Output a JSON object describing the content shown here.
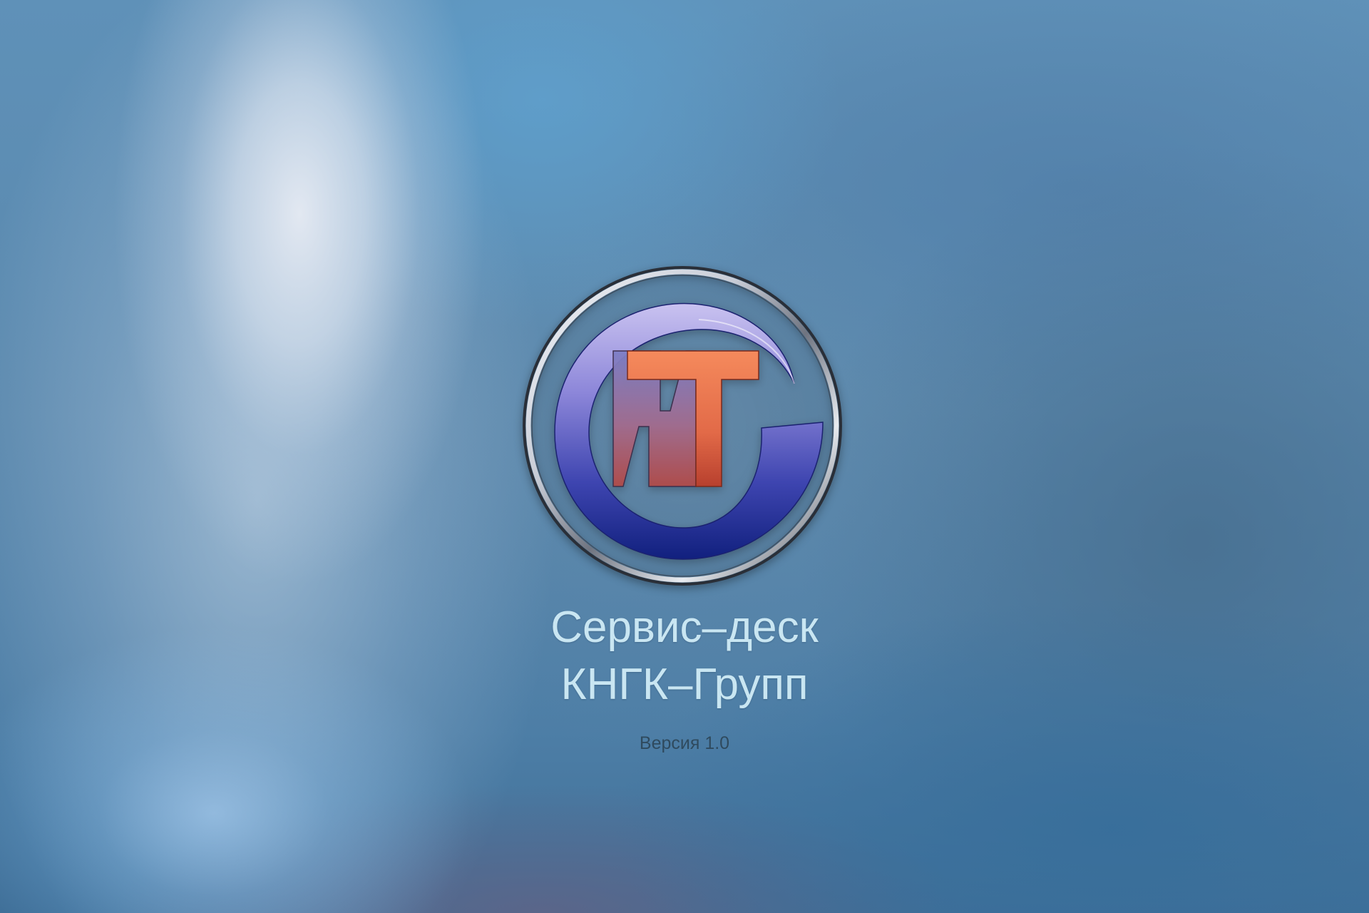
{
  "splash": {
    "logo_text": "ИТ",
    "title_line1": "Сервис–деск",
    "title_line2": "КНГК–Групп",
    "version": "Версия 1.0"
  },
  "colors": {
    "title": "#c9e6f2",
    "version": "#2f4a5e",
    "logo_orange": "#f2784f",
    "logo_blue": "#2a3a9c"
  },
  "icons": [
    "it-logo-icon"
  ]
}
